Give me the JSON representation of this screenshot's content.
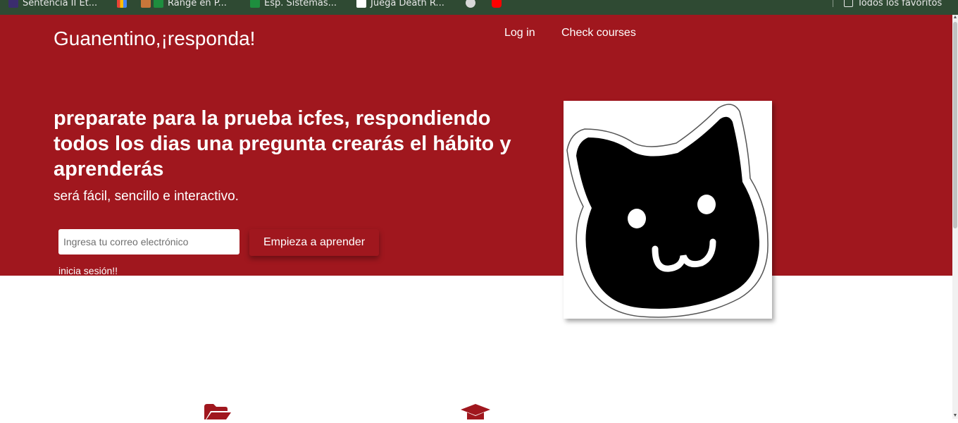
{
  "bookmarks": [
    {
      "label": "Sentencia II Et...",
      "icon": "w-logo-icon"
    },
    {
      "label": "",
      "icon": "gmail-icon"
    },
    {
      "label": "Range en P...",
      "icon": "sheets-icon"
    },
    {
      "label": "Esp. Sistemas...",
      "icon": "bookmark-green-icon"
    },
    {
      "label": "Juega Death R...",
      "icon": "game-icon"
    },
    {
      "label": "",
      "icon": "globe-icon"
    },
    {
      "label": "",
      "icon": "youtube-icon"
    }
  ],
  "bookmarks_right": {
    "label": "Todos los favoritos",
    "icon": "folder-icon"
  },
  "header": {
    "brand": "Guanentino,¡responda!",
    "nav": {
      "login": "Log in",
      "courses": "Check courses"
    }
  },
  "hero": {
    "headline": "preparate para la prueba icfes, respondiendo todos los dias una pregunta crearás el hábito y aprenderás",
    "subline": "será fácil, sencillo e interactivo.",
    "email_placeholder": "Ingresa tu correo electrónico",
    "email_value": "",
    "cta_label": "Empieza a aprender",
    "login_link": "inicia sesión!!"
  },
  "features": [
    {
      "icon": "folder-open-icon"
    },
    {
      "icon": "graduation-cap-icon"
    }
  ],
  "colors": {
    "brand_red": "#a0171e",
    "bookmarks_bar": "#2f4a33",
    "white": "#ffffff"
  }
}
